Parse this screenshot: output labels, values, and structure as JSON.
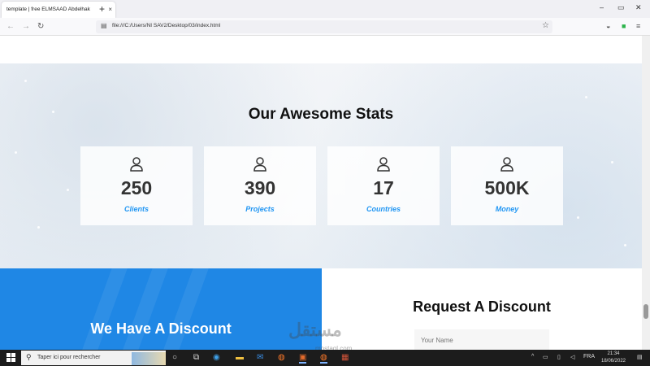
{
  "browser": {
    "tab_title": "template | free ELMSAAD Abdelhak",
    "tab_close": "×",
    "new_tab": "+",
    "url": "file:///C:/Users/NI SAV2/Desktop/03/index.html",
    "window_controls": {
      "minimize": "–",
      "restore": "▭",
      "close": "✕"
    }
  },
  "stats": {
    "title": "Our Awesome Stats",
    "items": [
      {
        "value": "250",
        "label": "Clients"
      },
      {
        "value": "390",
        "label": "Projects"
      },
      {
        "value": "17",
        "label": "Countries"
      },
      {
        "value": "500K",
        "label": "Money"
      }
    ],
    "icon": "user-icon"
  },
  "discount": {
    "title": "We Have A Discount",
    "request_title": "Request A Discount",
    "name_placeholder": "Your Name"
  },
  "watermark": {
    "arabic": "مستقل",
    "latin": "mostaql.com"
  },
  "taskbar": {
    "search_placeholder": "Taper ici pour rechercher",
    "language": "FRA",
    "time": "21:34",
    "date": "18/06/2022"
  },
  "colors": {
    "accent": "#2196f3",
    "discount_bg": "#1f87e5",
    "taskbar_bg": "#1c1c1c"
  }
}
